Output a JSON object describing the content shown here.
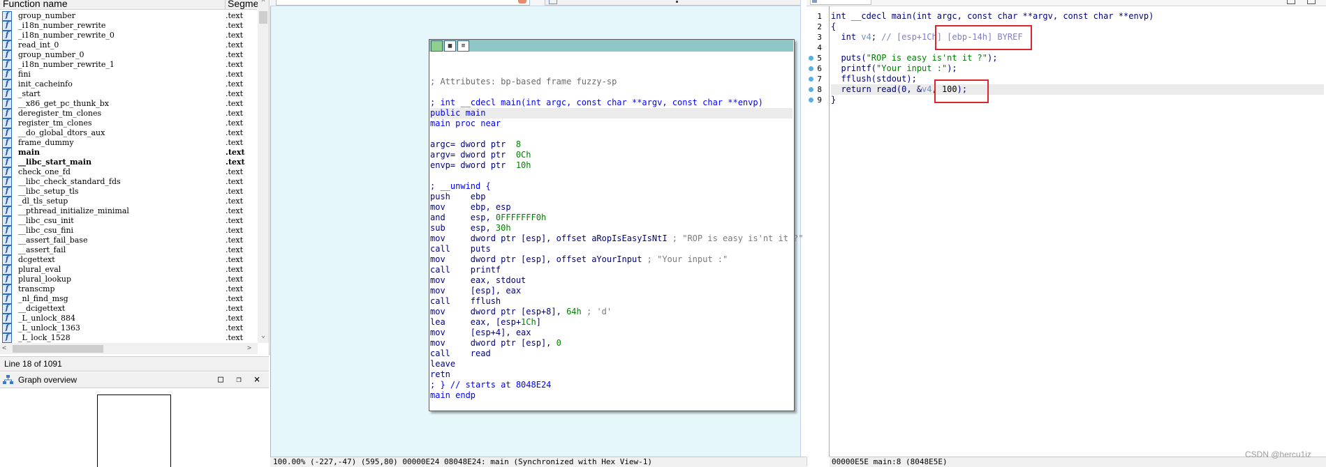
{
  "function_list": {
    "header_name": "Function name",
    "header_segment": "Segme",
    "rows": [
      {
        "name": "group_number",
        "segment": ".text"
      },
      {
        "name": "_i18n_number_rewrite",
        "segment": ".text"
      },
      {
        "name": "_i18n_number_rewrite_0",
        "segment": ".text"
      },
      {
        "name": "read_int_0",
        "segment": ".text"
      },
      {
        "name": "group_number_0",
        "segment": ".text"
      },
      {
        "name": "_i18n_number_rewrite_1",
        "segment": ".text"
      },
      {
        "name": "fini",
        "segment": ".text"
      },
      {
        "name": "init_cacheinfo",
        "segment": ".text"
      },
      {
        "name": "_start",
        "segment": ".text"
      },
      {
        "name": "__x86_get_pc_thunk_bx",
        "segment": ".text"
      },
      {
        "name": "deregister_tm_clones",
        "segment": ".text"
      },
      {
        "name": "register_tm_clones",
        "segment": ".text"
      },
      {
        "name": "__do_global_dtors_aux",
        "segment": ".text"
      },
      {
        "name": "frame_dummy",
        "segment": ".text"
      },
      {
        "name": "main",
        "segment": ".text",
        "bold": true
      },
      {
        "name": "__libc_start_main",
        "segment": ".text",
        "bold": true
      },
      {
        "name": "check_one_fd",
        "segment": ".text"
      },
      {
        "name": "__libc_check_standard_fds",
        "segment": ".text"
      },
      {
        "name": "__libc_setup_tls",
        "segment": ".text"
      },
      {
        "name": "_dl_tls_setup",
        "segment": ".text"
      },
      {
        "name": "__pthread_initialize_minimal",
        "segment": ".text"
      },
      {
        "name": "__libc_csu_init",
        "segment": ".text"
      },
      {
        "name": "__libc_csu_fini",
        "segment": ".text"
      },
      {
        "name": "__assert_fail_base",
        "segment": ".text"
      },
      {
        "name": "__assert_fail",
        "segment": ".text"
      },
      {
        "name": "dcgettext",
        "segment": ".text"
      },
      {
        "name": "plural_eval",
        "segment": ".text"
      },
      {
        "name": "plural_lookup",
        "segment": ".text"
      },
      {
        "name": "transcmp",
        "segment": ".text"
      },
      {
        "name": "_nl_find_msg",
        "segment": ".text"
      },
      {
        "name": "__dcigettext",
        "segment": ".text"
      },
      {
        "name": "_L_unlock_884",
        "segment": ".text"
      },
      {
        "name": "_L_unlock_1363",
        "segment": ".text"
      },
      {
        "name": "_L_lock_1528",
        "segment": ".text"
      }
    ],
    "status": "Line 18 of 1091",
    "icon": "function-icon"
  },
  "graph_overview": {
    "title": "Graph overview",
    "buttons": [
      "maximize-icon",
      "restore-icon",
      "close-icon"
    ]
  },
  "graph_view": {
    "status": "100.00% (-227,-47) (595,80) 00000E24 08048E24: main (Synchronized with Hex View-1)",
    "asm": {
      "attributes": "; Attributes: bp-based frame fuzzy-sp",
      "signature": "; int __cdecl main(int argc, const char **argv, const char **envp)",
      "public": "public main",
      "proc": "main proc near",
      "argc_name": "argc= dword ptr",
      "argc_val": "8",
      "argv_name": "argv= dword ptr",
      "argv_val": "0Ch",
      "envp_name": "envp= dword ptr",
      "envp_val": "10h",
      "unwind": "; __unwind {",
      "push_op": "push    ",
      "push_arg": "ebp",
      "mov1_op": "mov     ",
      "mov1_arg": "ebp, esp",
      "and_op": "and     ",
      "and_arg": "esp, ",
      "and_num": "0FFFFFFF0h",
      "sub_op": "sub     ",
      "sub_arg": "esp, ",
      "sub_num": "30h",
      "mov2_op": "mov     ",
      "mov2_arg": "dword ptr [esp], offset aRopIsEasyIsNtI",
      "mov2_cm": " ; \"ROP is easy is'nt it ?\"",
      "call1_op": "call    ",
      "call1_arg": "puts",
      "mov3_op": "mov     ",
      "mov3_arg": "dword ptr [esp], offset aYourInput",
      "mov3_cm": " ; \"Your input :\"",
      "call2_op": "call    ",
      "call2_arg": "printf",
      "mov4_op": "mov     ",
      "mov4_arg": "eax, stdout",
      "mov5_op": "mov     ",
      "mov5_arg": "[esp], eax",
      "call3_op": "call    ",
      "call3_arg": "fflush",
      "mov6_op": "mov     ",
      "mov6_arg": "dword ptr [esp+8], ",
      "mov6_num": "64h",
      "mov6_cm": " ; 'd'",
      "lea_op": "lea     ",
      "lea_arg": "eax, [esp+",
      "lea_num": "1Ch",
      "lea_end": "]",
      "mov7_op": "mov     ",
      "mov7_arg": "[esp+4], eax",
      "mov8_op": "mov     ",
      "mov8_arg": "dword ptr [esp], ",
      "mov8_num": "0",
      "call4_op": "call    ",
      "call4_arg": "read",
      "leave": "leave",
      "retn": "retn",
      "end_unwind": "; } // starts at 8048E24",
      "endp": "main endp"
    }
  },
  "pseudocode": {
    "line_numbers": [
      "1",
      "2",
      "3",
      "4",
      "5",
      "6",
      "7",
      "8",
      "9"
    ],
    "l1": "int __cdecl main(int argc, const char **argv, const char **envp)",
    "l2": "{",
    "l3_a": "  int ",
    "l3_v": "v4",
    "l3_b": "; ",
    "l3_cm": "// [esp+1Ch] [ebp-14h] BYREF",
    "l5_a": "  puts(",
    "l5_s": "\"ROP is easy is'nt it ?\"",
    "l5_b": ");",
    "l6_a": "  printf(",
    "l6_s": "\"Your input :\"",
    "l6_b": ");",
    "l7": "  fflush(stdout);",
    "l8_a": "  return read(0, &",
    "l8_v": "v4",
    "l8_b": ", ",
    "l8_n": "100",
    "l8_c": ");",
    "l9": "}",
    "status": "00000E5E main:8 (8048E5E)"
  },
  "watermark": "CSDN @hercu1iz",
  "colors": {
    "graph_bg": "#e6f7fb",
    "highlight_box": "#e0242c",
    "node_title": "#8fc7c9",
    "keyword_blue": "#000080",
    "string_green": "#008000"
  }
}
